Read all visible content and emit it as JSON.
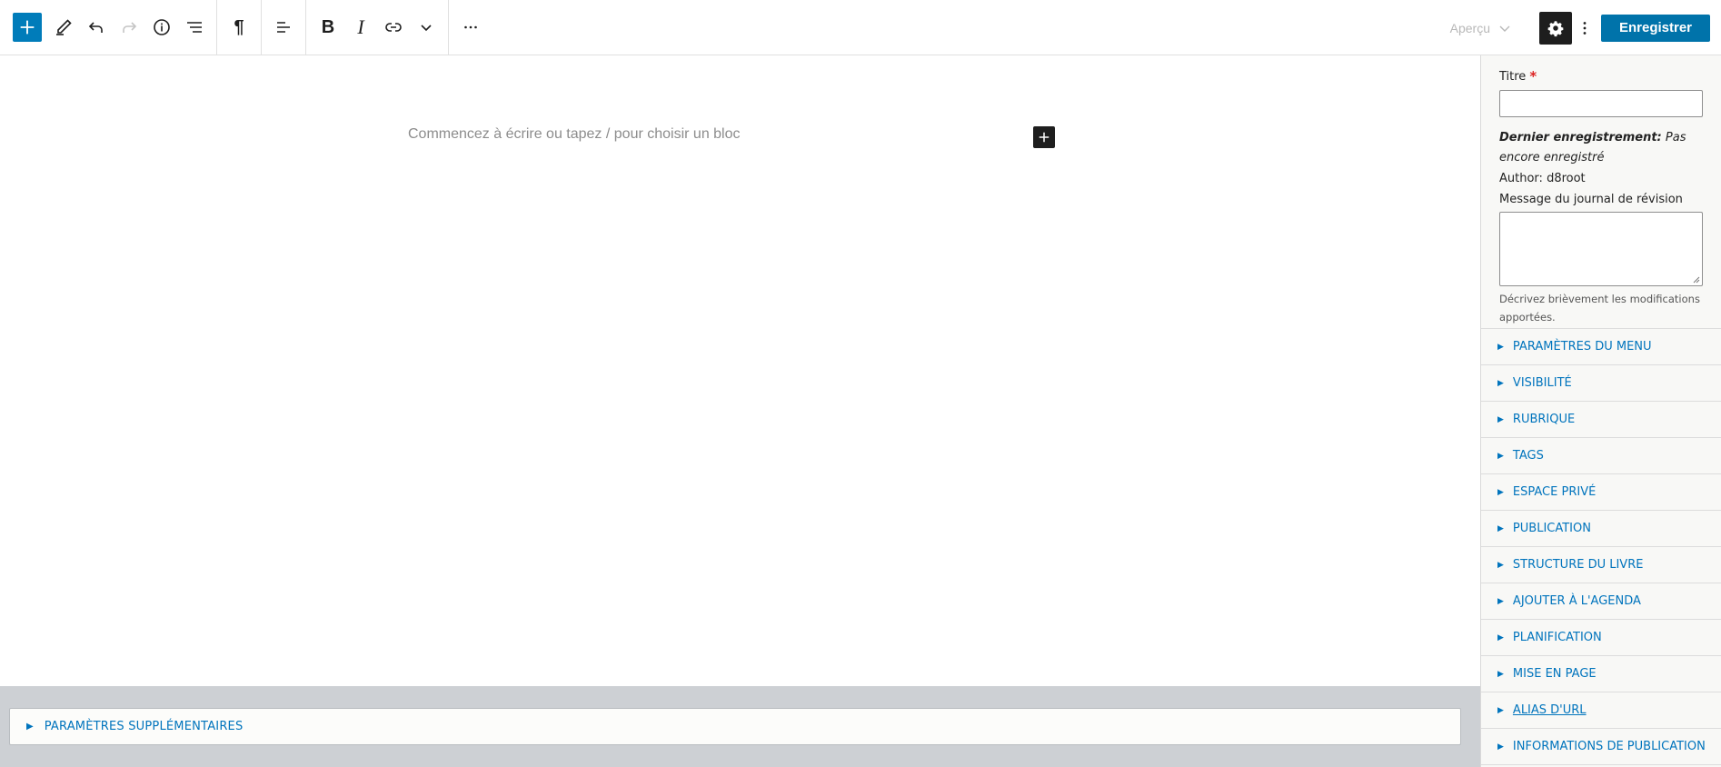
{
  "toolbar": {
    "preview_label": "Aperçu",
    "save_label": "Enregistrer"
  },
  "editor": {
    "placeholder": "Commencez à écrire ou tapez / pour choisir un bloc"
  },
  "bottom": {
    "extra_settings_label": "PARAMÈTRES SUPPLÉMENTAIRES"
  },
  "sidebar": {
    "title_label": "Titre",
    "required_mark": "*",
    "last_save_label": "Dernier enregistrement:",
    "last_save_value": "Pas encore enregistré",
    "author_label": "Author:",
    "author_value": "d8root",
    "revision_label": "Message du journal de révision",
    "revision_help": "Décrivez brièvement les modifications apportées.",
    "sections": [
      {
        "label": "PARAMÈTRES DU MENU"
      },
      {
        "label": "VISIBILITÉ"
      },
      {
        "label": "RUBRIQUE"
      },
      {
        "label": "TAGS"
      },
      {
        "label": "ESPACE PRIVÉ"
      },
      {
        "label": "PUBLICATION"
      },
      {
        "label": "STRUCTURE DU LIVRE"
      },
      {
        "label": "AJOUTER À L'AGENDA"
      },
      {
        "label": "PLANIFICATION"
      },
      {
        "label": "MISE EN PAGE"
      },
      {
        "label": "ALIAS D'URL"
      },
      {
        "label": "INFORMATIONS DE PUBLICATION"
      }
    ]
  },
  "colors": {
    "accent": "#007cba",
    "link": "#0074bd",
    "dark": "#1e1e1e"
  }
}
